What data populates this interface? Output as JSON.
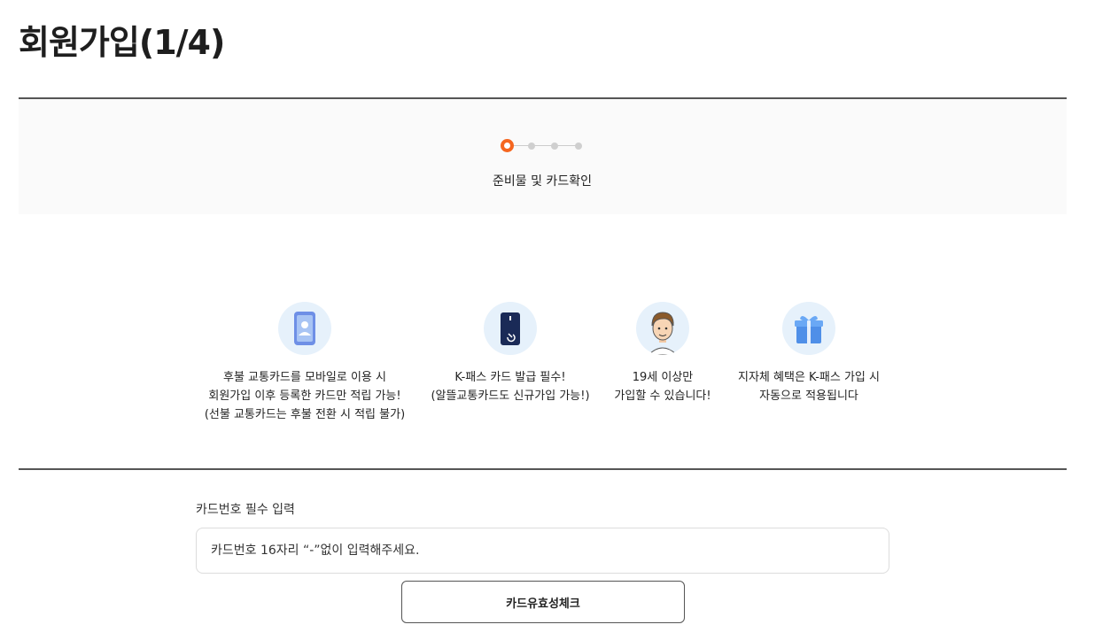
{
  "page": {
    "title": "회원가입(1/4)"
  },
  "stepper": {
    "total_steps": 4,
    "current_step": 1,
    "current_label": "준비물 및 카드확인",
    "active_color": "#f5661f"
  },
  "info_items": [
    {
      "icon": "mobile-phone-icon",
      "lines": [
        "후불 교통카드를 모바일로 이용 시",
        "회원가입 이후 등록한 카드만 적립 가능!",
        "(선불 교통카드는 후불 전환 시 적립 불가)"
      ]
    },
    {
      "icon": "k-pass-card-icon",
      "lines": [
        "K-패스 카드 발급 필수!",
        "(알뜰교통카드도 신규가입 가능!)"
      ]
    },
    {
      "icon": "person-avatar-icon",
      "lines": [
        "19세 이상만",
        "가입할 수 있습니다!"
      ]
    },
    {
      "icon": "gift-box-icon",
      "lines": [
        "지자체 혜택은 K-패스 가입 시",
        "자동으로 적용됩니다"
      ]
    }
  ],
  "card_form": {
    "label": "카드번호 필수 입력",
    "placeholder": "카드번호 16자리 “-”없이 입력해주세요.",
    "value": "",
    "check_button_label": "카드유효성체크"
  }
}
